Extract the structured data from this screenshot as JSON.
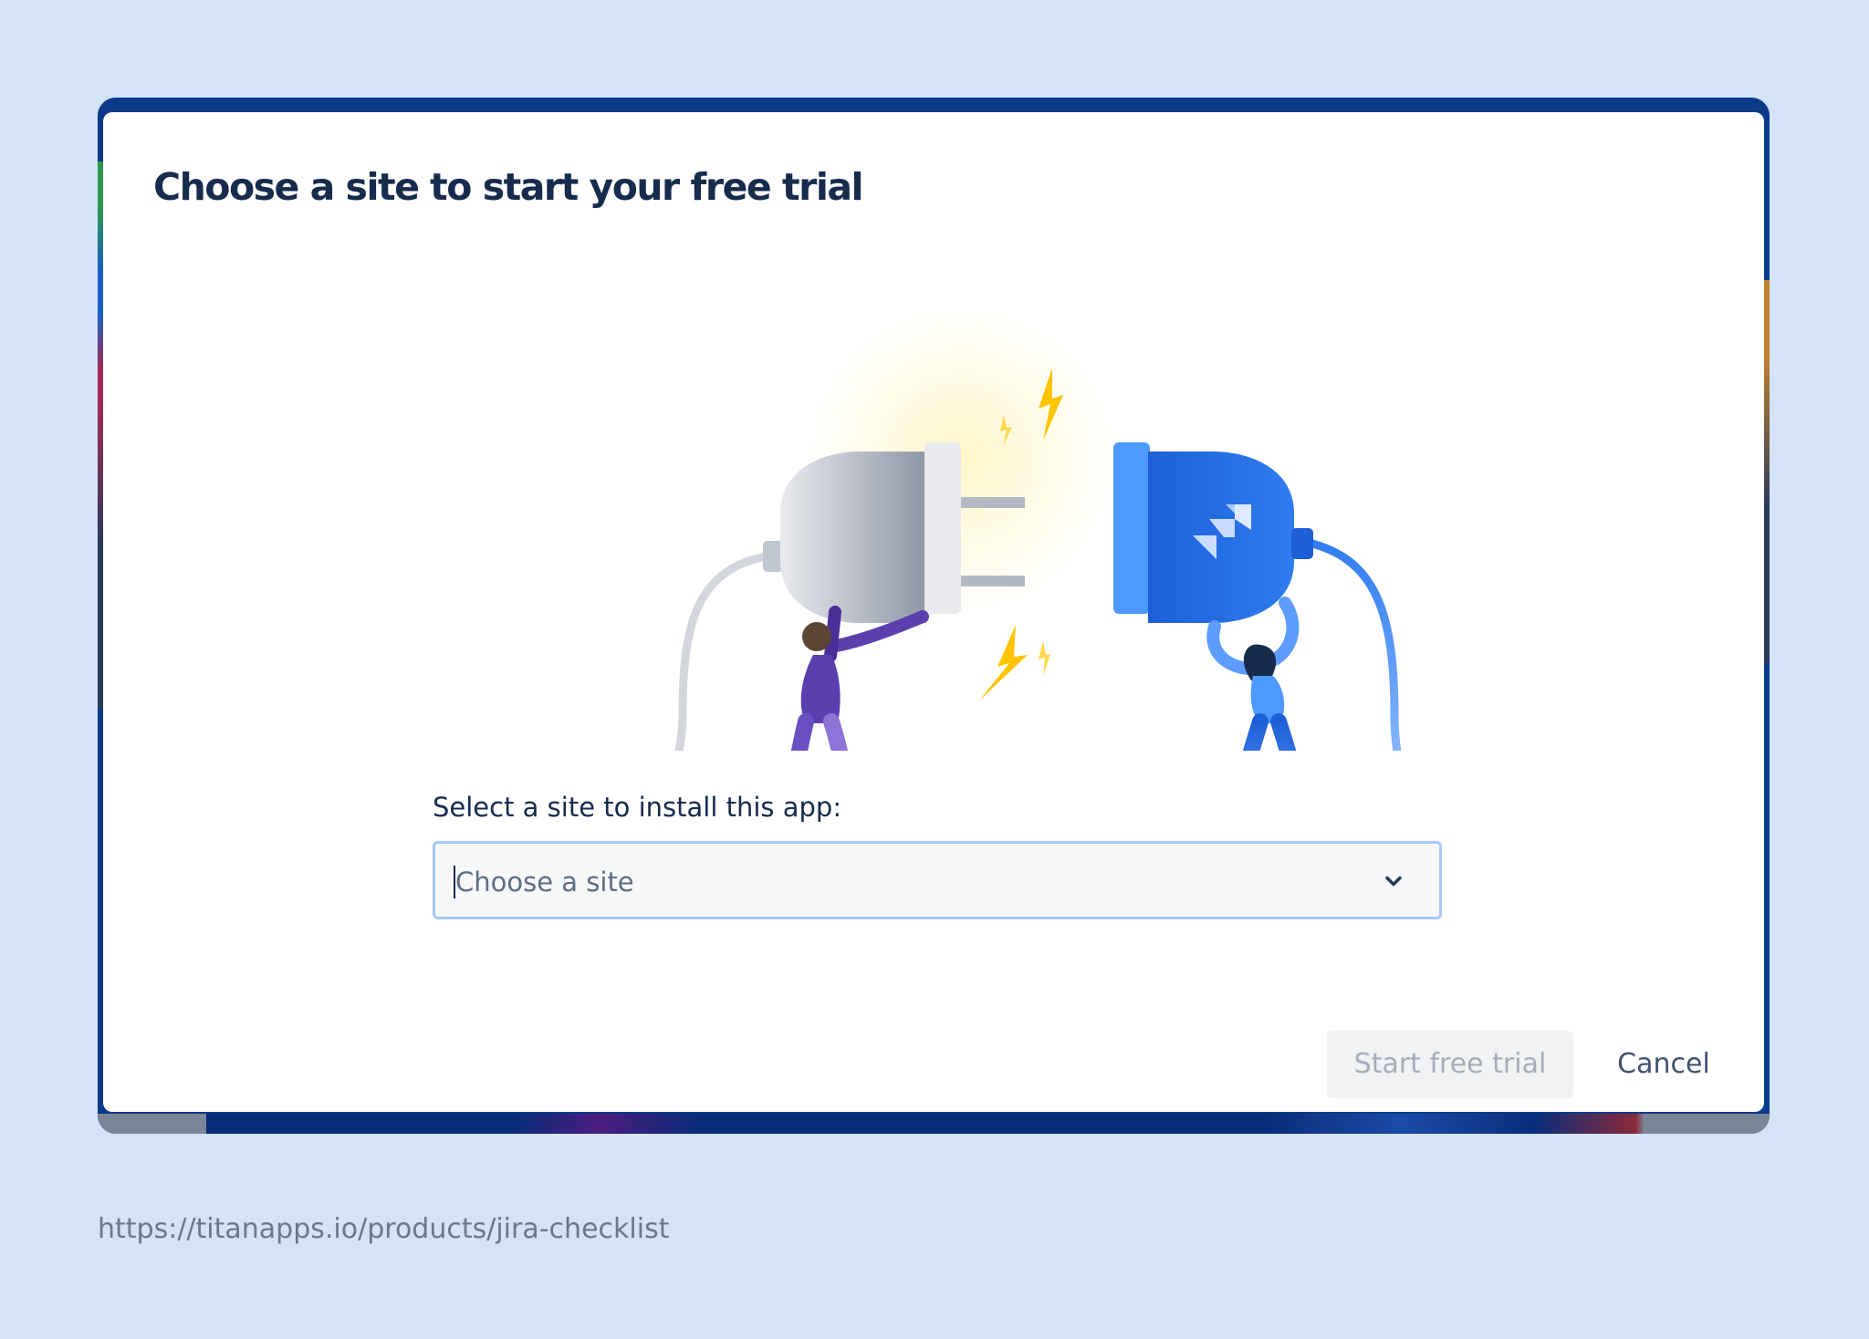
{
  "dialog": {
    "title": "Choose a site to start your free trial",
    "site_select": {
      "label": "Select a site to install this app:",
      "placeholder": "Choose a site"
    },
    "buttons": {
      "start_trial_label": "Start free trial",
      "cancel_label": "Cancel"
    }
  },
  "footer": {
    "source_url": "https://titanapps.io/products/jira-checklist"
  },
  "colors": {
    "page_background": "#d4e3f8",
    "frame_border": "#0b3a8a",
    "title_text": "#172b4d",
    "select_border": "#a6c8f8",
    "jira_blue": "#1868db",
    "disabled_button_bg": "#f1f2f4"
  },
  "icons": {
    "select_chevron": "chevron-down-icon",
    "illustration": "plug-connect-illustration",
    "jira_logo": "jira-logo-icon"
  }
}
